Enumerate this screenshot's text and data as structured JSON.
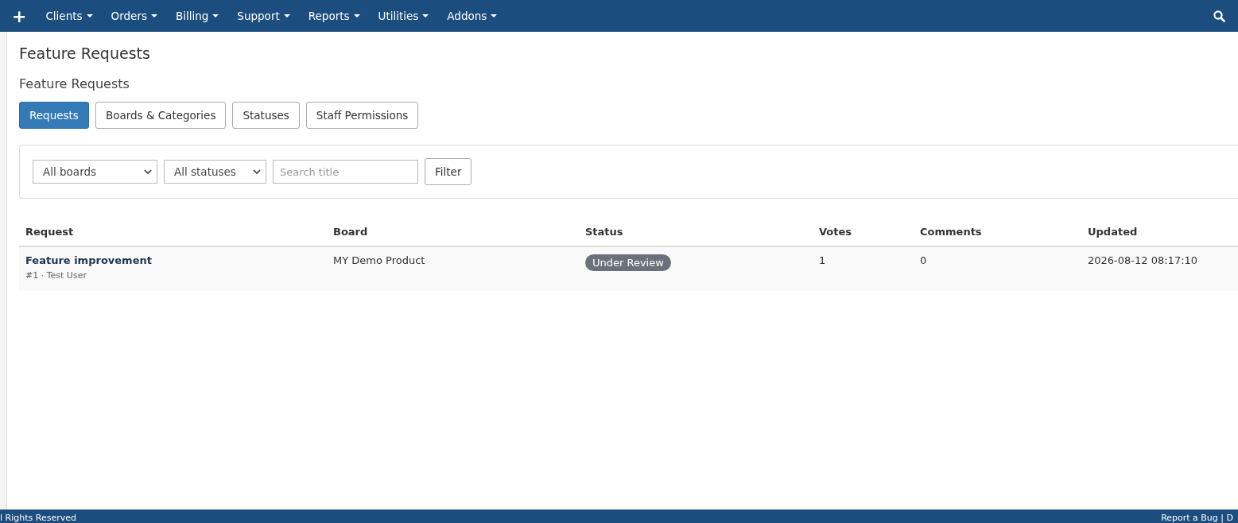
{
  "navbar": {
    "add_label": "+",
    "menus": [
      {
        "label": "Clients"
      },
      {
        "label": "Orders"
      },
      {
        "label": "Billing"
      },
      {
        "label": "Support"
      },
      {
        "label": "Reports"
      },
      {
        "label": "Utilities"
      },
      {
        "label": "Addons"
      }
    ]
  },
  "page_title": "Feature Requests",
  "section_title": "Feature Requests",
  "tabs": [
    {
      "label": "Requests",
      "selected": true
    },
    {
      "label": "Boards & Categories",
      "selected": false
    },
    {
      "label": "Statuses",
      "selected": false
    },
    {
      "label": "Staff Permissions",
      "selected": false
    }
  ],
  "filters": {
    "board": "All boards",
    "status": "All statuses",
    "search": {
      "placeholder": "Search title"
    },
    "button": "Filter"
  },
  "table": {
    "columns": [
      "Request",
      "Board",
      "Status",
      "Votes",
      "Comments",
      "Updated"
    ],
    "rows": [
      {
        "title": "Feature improvement",
        "meta": "#1 · Test User",
        "board": "MY Demo Product",
        "status": "Under Review",
        "votes": "1",
        "comments": "0",
        "updated": "2026-08-12 08:17:10"
      }
    ]
  },
  "footer": {
    "left": "l Rights Reserved",
    "right": "Report a Bug | D"
  }
}
